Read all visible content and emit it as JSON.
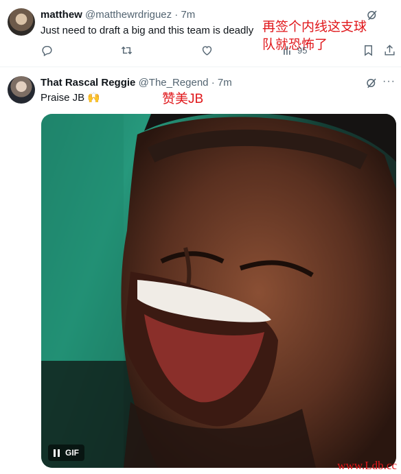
{
  "tweets": [
    {
      "name": "matthew",
      "handle": "@matthewrdriguez",
      "dot": "·",
      "time": "7m",
      "text": "Just need to draft a big and this team is deadly",
      "annotation_line1": "再签个内线这支球",
      "annotation_line2": "队就恐怖了",
      "views": "95",
      "icons": [
        "grok-icon",
        "reply-icon",
        "retweet-icon",
        "like-icon",
        "views-icon",
        "bookmark-icon",
        "share-icon"
      ]
    },
    {
      "name": "That Rascal Reggie",
      "handle": "@The_Regend",
      "dot": "·",
      "time": "7m",
      "text": "Praise JB 🙌",
      "annotation": "赞美JB",
      "media": {
        "type": "gif",
        "gif_label": "GIF",
        "icons": [
          "pause-icon"
        ]
      },
      "icons": [
        "grok-icon",
        "more-icon"
      ]
    }
  ],
  "watermark": "www.Ldb.cc",
  "colors": {
    "annotation": "#e0161a",
    "secondary_text": "#536471",
    "primary_text": "#0f1419",
    "divider": "#eff3f4"
  }
}
